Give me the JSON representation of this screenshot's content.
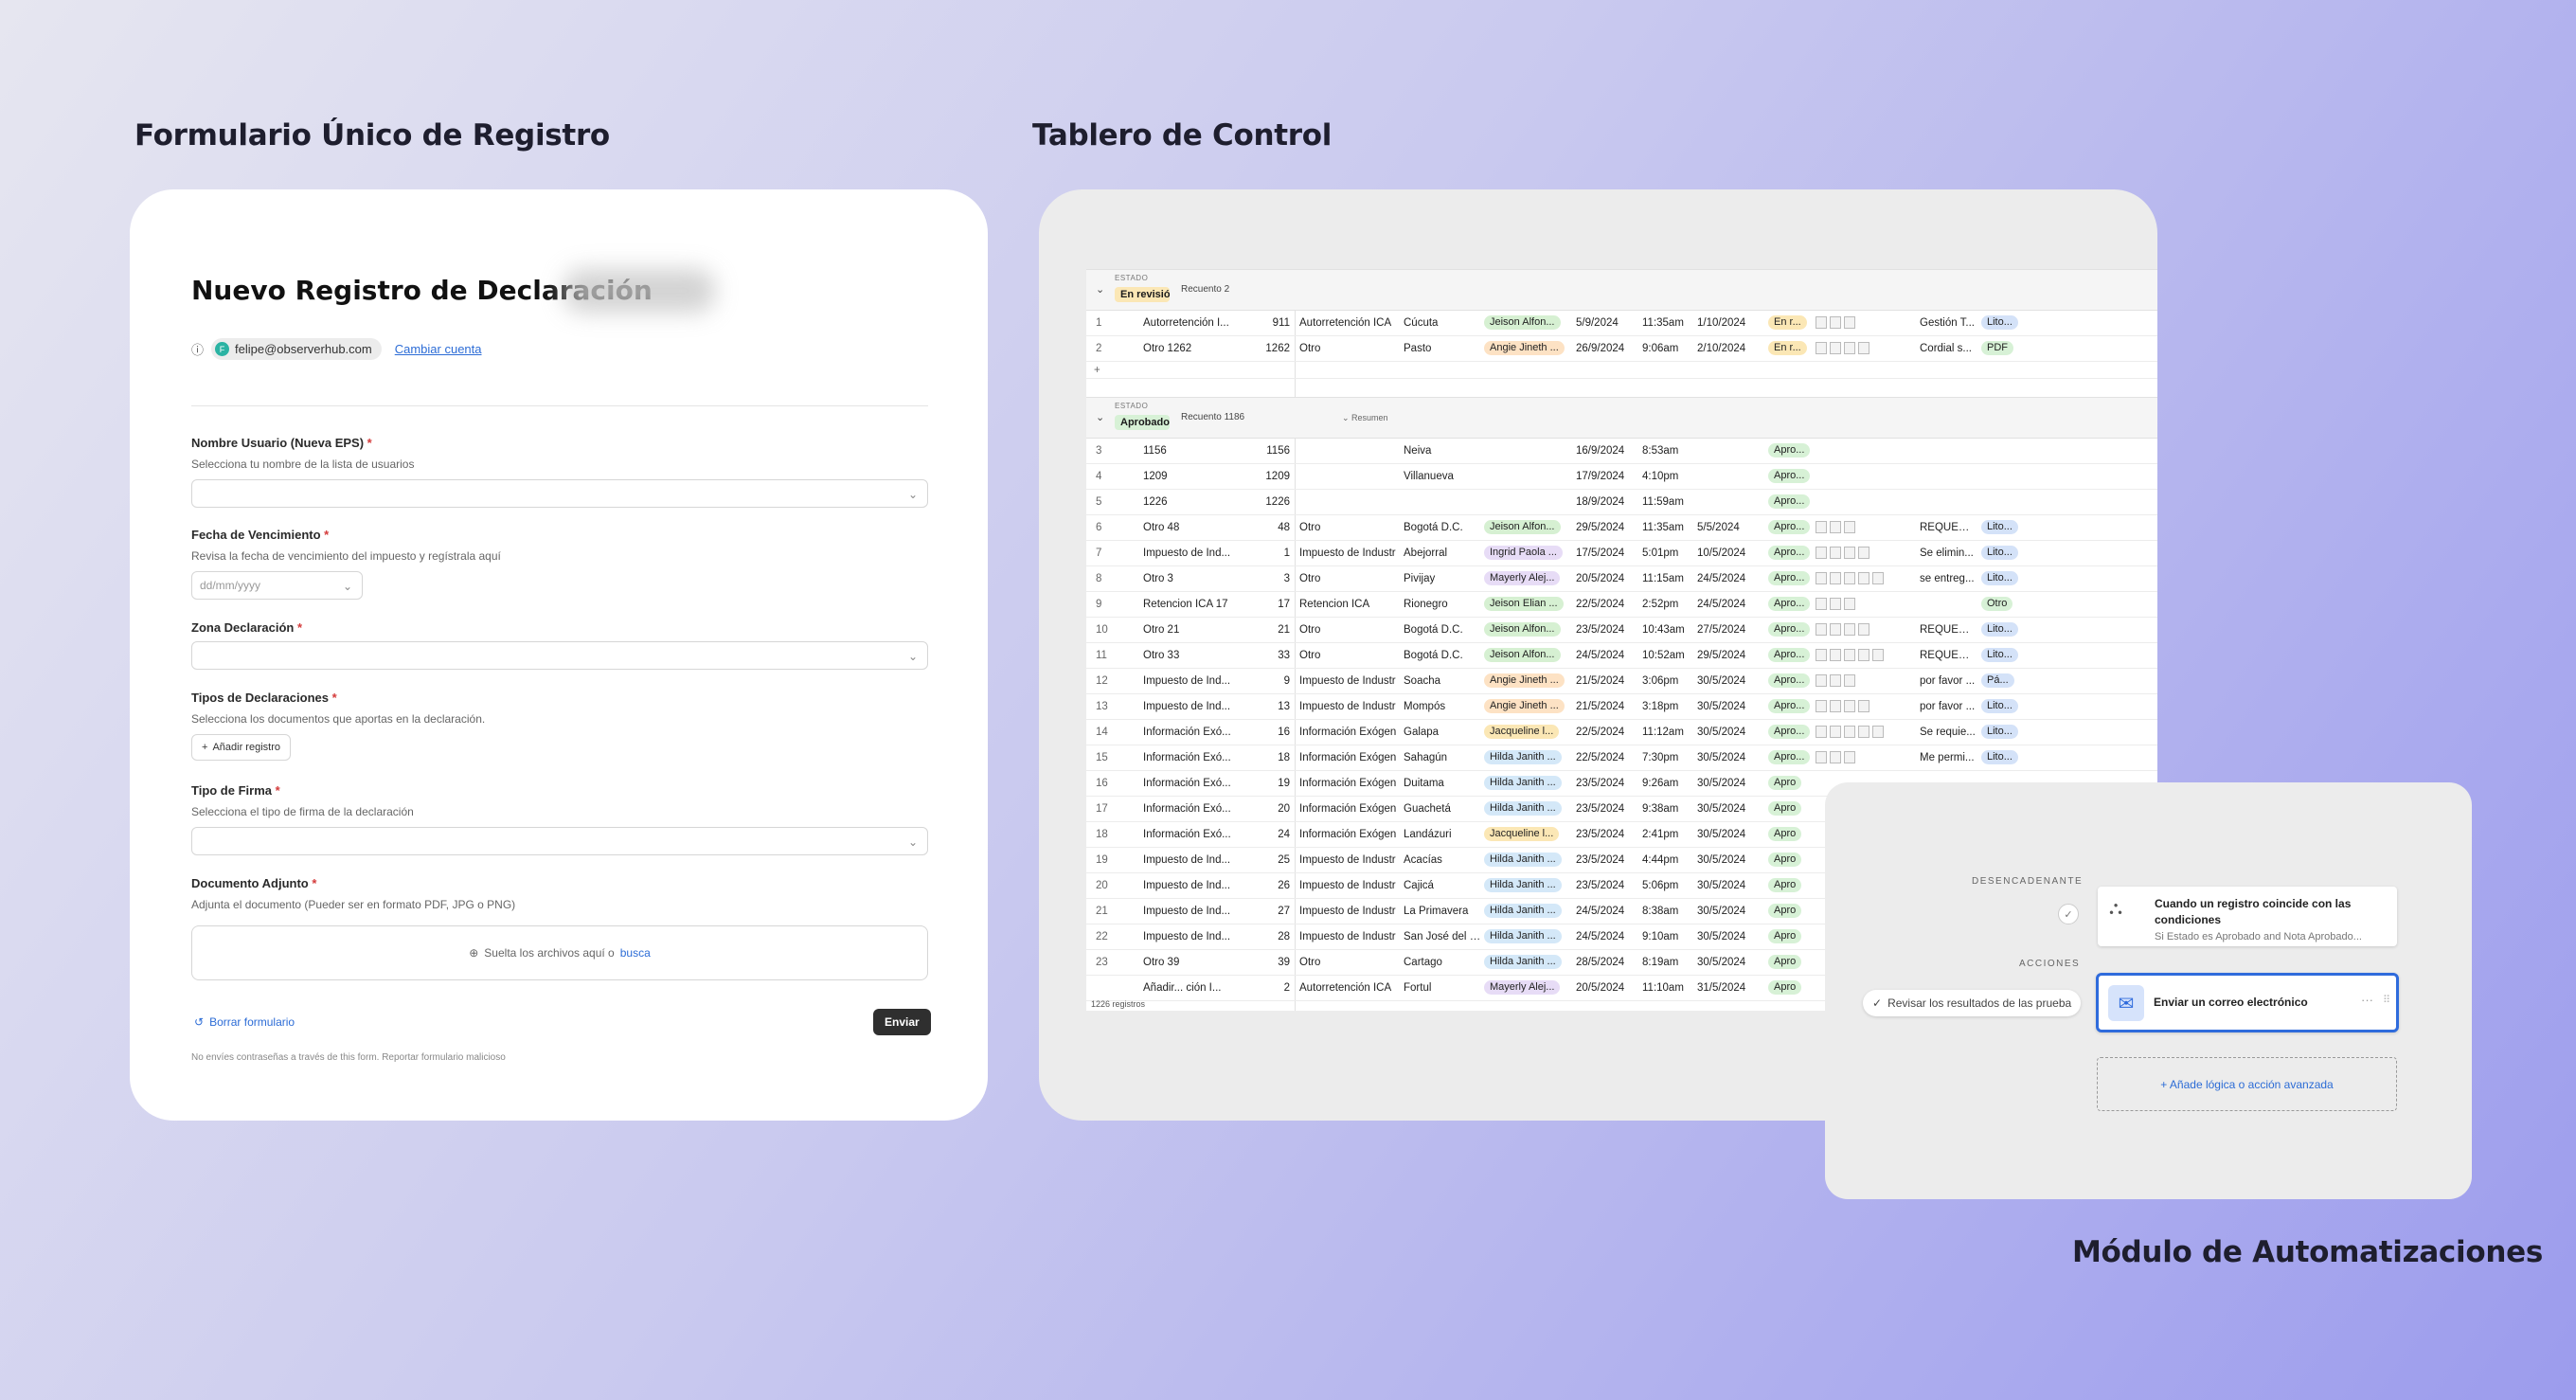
{
  "sections": {
    "form_title": "Formulario Único de Registro",
    "dashboard_title": "Tablero de Control",
    "automations_title": "Módulo de Automatizaciones"
  },
  "form": {
    "heading": "Nuevo Registro de Declaración",
    "account_email": "felipe@observerhub.com",
    "account_initial": "F",
    "change_account": "Cambiar cuenta",
    "fields": [
      {
        "label": "Nombre Usuario (Nueva EPS)",
        "required": "*",
        "hint": "Selecciona tu nombre de la lista de usuarios"
      },
      {
        "label": "Fecha de Vencimiento",
        "required": "*",
        "hint": "Revisa la fecha de vencimiento del impuesto y regístrala aquí",
        "placeholder": "dd/mm/yyyy"
      },
      {
        "label": "Zona Declaración",
        "required": "*"
      },
      {
        "label": "Tipos de Declaraciones",
        "required": "*",
        "hint": "Selecciona los documentos que aportas en la declaración.",
        "button": "Añadir registro"
      },
      {
        "label": "Tipo de Firma",
        "required": "*",
        "hint": "Selecciona el tipo de firma de la declaración"
      },
      {
        "label": "Documento Adjunto",
        "required": "*",
        "hint": "Adjunta el documento (Pueder ser en formato PDF, JPG o PNG)",
        "drop_text": "Suelta los archivos aquí o",
        "drop_link": "busca"
      }
    ],
    "clear_label": "Borrar formulario",
    "submit_label": "Enviar",
    "footer": "No envíes contraseñas a través de this form. Reportar formulario malicioso"
  },
  "dashboard": {
    "group_field": "ESTADO",
    "groups": [
      {
        "value": "En revisión",
        "count": "Recuento 2",
        "color": "#fbe7b5"
      },
      {
        "value": "Aprobado",
        "count": "Recuento 1186",
        "color": "#d7f1d6",
        "summary": "Resumen"
      }
    ],
    "rows_group1": [
      [
        "1",
        "Autorretención I...",
        "911",
        "Autorretención ICA",
        "Cúcuta",
        "Jeison Alfon...",
        "5/9/2024",
        "11:35am",
        "1/10/2024",
        "En r...",
        "",
        "Gestión T...",
        "Lito..."
      ],
      [
        "2",
        "Otro 1262",
        "1262",
        "Otro",
        "Pasto",
        "Angie Jineth ...",
        "26/9/2024",
        "9:06am",
        "2/10/2024",
        "En r...",
        "",
        "Cordial s...",
        "PDF"
      ]
    ],
    "rows_group2": [
      [
        "3",
        "1156",
        "1156",
        "",
        "Neiva",
        "",
        "16/9/2024",
        "8:53am",
        "",
        "Apro...",
        "",
        "",
        ""
      ],
      [
        "4",
        "1209",
        "1209",
        "",
        "Villanueva",
        "",
        "17/9/2024",
        "4:10pm",
        "",
        "Apro...",
        "",
        "",
        ""
      ],
      [
        "5",
        "1226",
        "1226",
        "",
        "",
        "",
        "18/9/2024",
        "11:59am",
        "",
        "Apro...",
        "",
        "",
        ""
      ],
      [
        "6",
        "Otro 48",
        "48",
        "Otro",
        "Bogotá D.C.",
        "Jeison Alfon...",
        "29/5/2024",
        "11:35am",
        "5/5/2024",
        "Apro...",
        "",
        "REQUERI...",
        "Lito..."
      ],
      [
        "7",
        "Impuesto de Ind...",
        "1",
        "Impuesto de Industr",
        "Abejorral",
        "Ingrid Paola ...",
        "17/5/2024",
        "5:01pm",
        "10/5/2024",
        "Apro...",
        "",
        "Se elimin...",
        "Lito..."
      ],
      [
        "8",
        "Otro 3",
        "3",
        "Otro",
        "Pivijay",
        "Mayerly Alej...",
        "20/5/2024",
        "11:15am",
        "24/5/2024",
        "Apro...",
        "",
        "se entreg...",
        "Lito..."
      ],
      [
        "9",
        "Retencion ICA 17",
        "17",
        "Retencion ICA",
        "Rionegro",
        "Jeison Elian ...",
        "22/5/2024",
        "2:52pm",
        "24/5/2024",
        "Apro...",
        "",
        "",
        "Otro"
      ],
      [
        "10",
        "Otro 21",
        "21",
        "Otro",
        "Bogotá D.C.",
        "Jeison Alfon...",
        "23/5/2024",
        "10:43am",
        "27/5/2024",
        "Apro...",
        "",
        "REQUERI...",
        "Lito..."
      ],
      [
        "11",
        "Otro 33",
        "33",
        "Otro",
        "Bogotá D.C.",
        "Jeison Alfon...",
        "24/5/2024",
        "10:52am",
        "29/5/2024",
        "Apro...",
        "",
        "REQUERI...",
        "Lito..."
      ],
      [
        "12",
        "Impuesto de Ind...",
        "9",
        "Impuesto de Industr",
        "Soacha",
        "Angie Jineth ...",
        "21/5/2024",
        "3:06pm",
        "30/5/2024",
        "Apro...",
        "",
        "por favor ...",
        "Pá..."
      ],
      [
        "13",
        "Impuesto de Ind...",
        "13",
        "Impuesto de Industr",
        "Mompós",
        "Angie Jineth ...",
        "21/5/2024",
        "3:18pm",
        "30/5/2024",
        "Apro...",
        "",
        "por favor ...",
        "Lito..."
      ],
      [
        "14",
        "Información Exó...",
        "16",
        "Información Exógen",
        "Galapa",
        "Jacqueline l...",
        "22/5/2024",
        "11:12am",
        "30/5/2024",
        "Apro...",
        "",
        "Se requie...",
        "Lito..."
      ],
      [
        "15",
        "Información Exó...",
        "18",
        "Información Exógen",
        "Sahagún",
        "Hilda Janith ...",
        "22/5/2024",
        "7:30pm",
        "30/5/2024",
        "Apro...",
        "",
        "Me permi...",
        "Lito..."
      ],
      [
        "16",
        "Información Exó...",
        "19",
        "Información Exógen",
        "Duitama",
        "Hilda Janith ...",
        "23/5/2024",
        "9:26am",
        "30/5/2024",
        "Apro",
        "",
        "",
        ""
      ],
      [
        "17",
        "Información Exó...",
        "20",
        "Información Exógen",
        "Guachetá",
        "Hilda Janith ...",
        "23/5/2024",
        "9:38am",
        "30/5/2024",
        "Apro",
        "",
        "",
        ""
      ],
      [
        "18",
        "Información Exó...",
        "24",
        "Información Exógen",
        "Landázuri",
        "Jacqueline l...",
        "23/5/2024",
        "2:41pm",
        "30/5/2024",
        "Apro",
        "",
        "",
        ""
      ],
      [
        "19",
        "Impuesto de Ind...",
        "25",
        "Impuesto de Industr",
        "Acacías",
        "Hilda Janith ...",
        "23/5/2024",
        "4:44pm",
        "30/5/2024",
        "Apro",
        "",
        "",
        ""
      ],
      [
        "20",
        "Impuesto de Ind...",
        "26",
        "Impuesto de Industr",
        "Cajicá",
        "Hilda Janith ...",
        "23/5/2024",
        "5:06pm",
        "30/5/2024",
        "Apro",
        "",
        "",
        ""
      ],
      [
        "21",
        "Impuesto de Ind...",
        "27",
        "Impuesto de Industr",
        "La Primavera",
        "Hilda Janith ...",
        "24/5/2024",
        "8:38am",
        "30/5/2024",
        "Apro",
        "",
        "",
        ""
      ],
      [
        "22",
        "Impuesto de Ind...",
        "28",
        "Impuesto de Industr",
        "San José del Gu",
        "Hilda Janith ...",
        "24/5/2024",
        "9:10am",
        "30/5/2024",
        "Apro",
        "",
        "",
        ""
      ],
      [
        "23",
        "Otro 39",
        "39",
        "Otro",
        "Cartago",
        "Hilda Janith ...",
        "28/5/2024",
        "8:19am",
        "30/5/2024",
        "Apro",
        "",
        "",
        ""
      ],
      [
        "",
        "Añadir...  ción I...",
        "2",
        "Autorretención ICA",
        "Fortul",
        "Mayerly Alej...",
        "20/5/2024",
        "11:10am",
        "31/5/2024",
        "Apro",
        "",
        "",
        ""
      ]
    ],
    "footer": "1226 registros",
    "person_colors": {
      "Jeison": "#d6f0d2",
      "Angie": "#fde2c4",
      "Ingrid": "#e7dcf6",
      "Mayerly": "#e7dcf6",
      "Jacqueline": "#fbe7b5",
      "Hilda": "#d4e8f8"
    }
  },
  "automation": {
    "trigger_label": "DESENCADENANTE",
    "trigger_title": "Cuando un registro coincide con las condiciones",
    "trigger_sub": "Si Estado es Aprobado and Nota Aprobado...",
    "actions_label": "ACCIONES",
    "test_label": "Revisar los resultados de las prueba",
    "action_title": "Enviar un correo electrónico",
    "add_label": "+ Añade lógica o acción avanzada"
  }
}
